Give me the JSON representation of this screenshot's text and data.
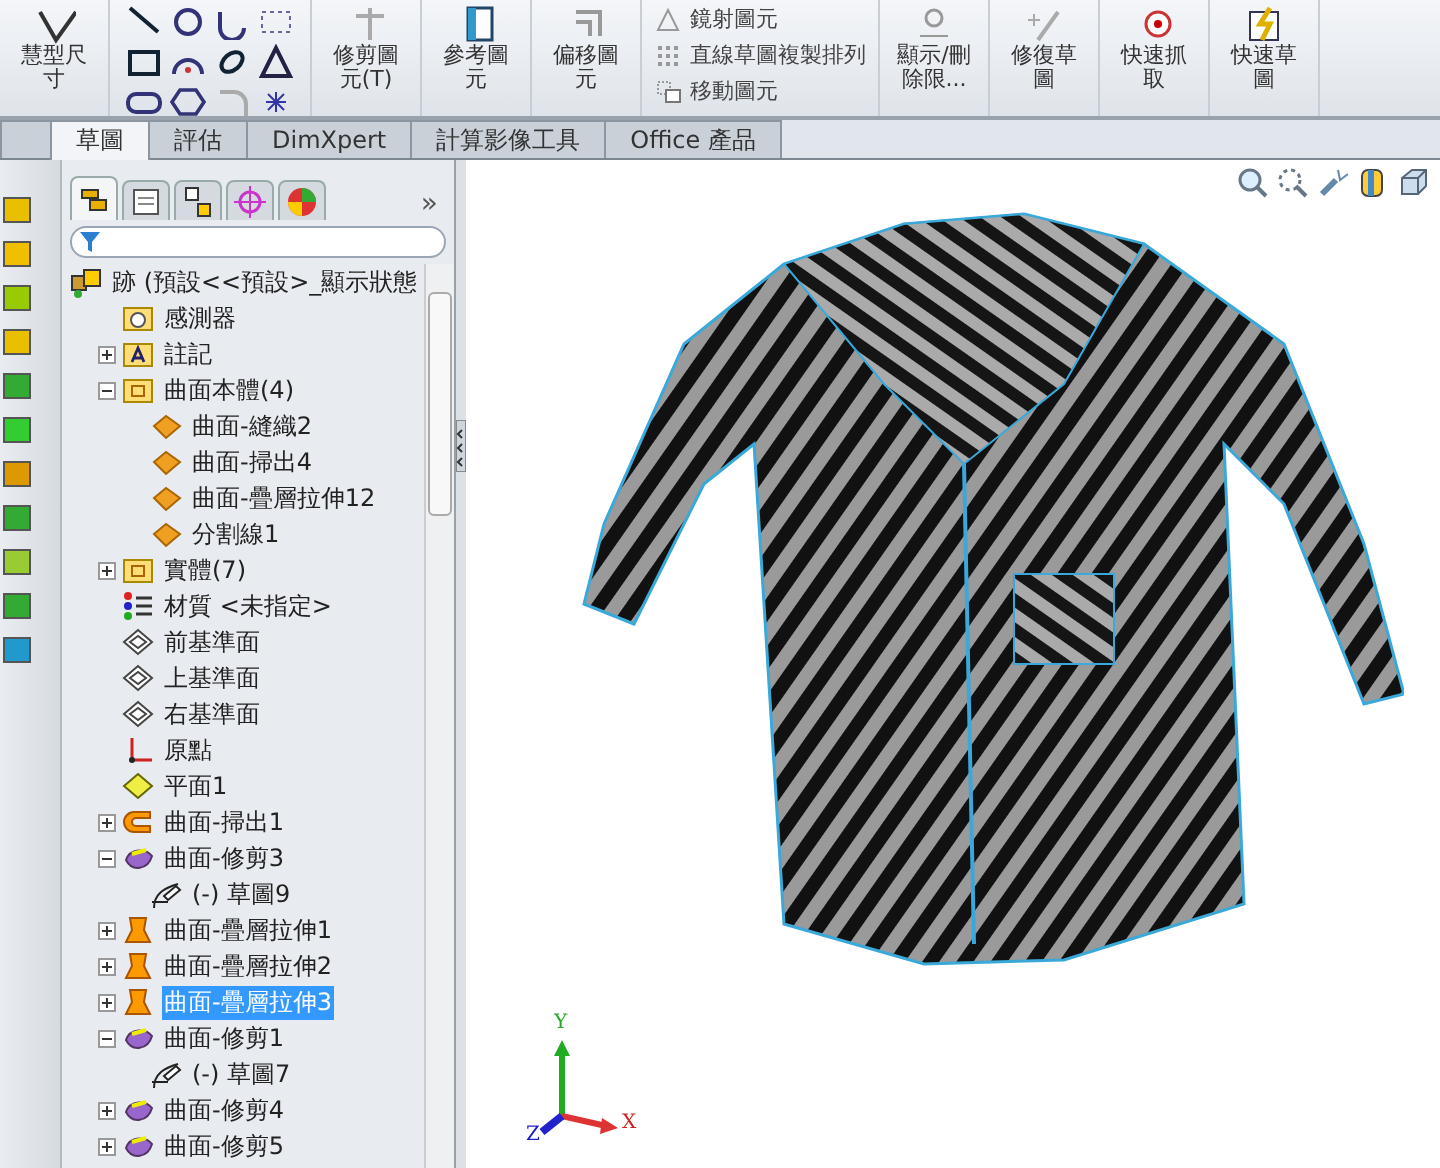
{
  "ribbon": [
    {
      "kind": "large",
      "label": "慧型尺寸"
    },
    {
      "kind": "tools"
    },
    {
      "kind": "large",
      "label": "修剪圖元(T)"
    },
    {
      "kind": "large",
      "label": "參考圖元"
    },
    {
      "kind": "large",
      "label": "偏移圖元"
    },
    {
      "kind": "rows",
      "items": [
        "鏡射圖元",
        "直線草圖複製排列",
        "移動圖元"
      ]
    },
    {
      "kind": "large",
      "label": "顯示/刪除限..."
    },
    {
      "kind": "large",
      "label": "修復草圖"
    },
    {
      "kind": "large",
      "label": "快速抓取"
    },
    {
      "kind": "large",
      "label": "快速草圖"
    }
  ],
  "tabs": [
    {
      "selected": false
    },
    {
      "label": "草圖",
      "selected": true
    },
    {
      "label": "評估",
      "selected": false
    },
    {
      "label": "DimXpert",
      "selected": false
    },
    {
      "label": "計算影像工具",
      "selected": false
    },
    {
      "label": "Office 產品",
      "selected": false
    }
  ],
  "panel_tabs": [
    {
      "kind": "feature",
      "selected": true
    },
    {
      "kind": "property",
      "selected": false
    },
    {
      "kind": "config",
      "selected": false
    },
    {
      "kind": "dim",
      "selected": false
    },
    {
      "kind": "display",
      "selected": false
    }
  ],
  "panel_overflow": "»",
  "tree": [
    {
      "kind": "part",
      "label": "跡 (預設<<預設>_顯示狀態",
      "selected": false,
      "children": [
        {
          "kind": "sensor",
          "label": "感測器",
          "selected": false
        },
        {
          "kind": "annotation",
          "label": "註記",
          "selected": false,
          "expanded": false
        },
        {
          "kind": "folder",
          "label": "曲面本體(4)",
          "selected": false,
          "expanded": true,
          "children": [
            {
              "kind": "surface",
              "label": "曲面-縫織2",
              "selected": false
            },
            {
              "kind": "surface",
              "label": "曲面-掃出4",
              "selected": false
            },
            {
              "kind": "surface",
              "label": "曲面-疊層拉伸12",
              "selected": false
            },
            {
              "kind": "surface",
              "label": "分割線1",
              "selected": false
            }
          ]
        },
        {
          "kind": "folder",
          "label": "實體(7)",
          "selected": false,
          "expanded": false
        },
        {
          "kind": "material",
          "label": "材質 <未指定>",
          "selected": false
        },
        {
          "kind": "plane",
          "label": "前基準面",
          "selected": false
        },
        {
          "kind": "plane",
          "label": "上基準面",
          "selected": false
        },
        {
          "kind": "plane",
          "label": "右基準面",
          "selected": false
        },
        {
          "kind": "origin",
          "label": "原點",
          "selected": false
        },
        {
          "kind": "refplane",
          "label": "平面1",
          "selected": false
        },
        {
          "kind": "sweep",
          "label": "曲面-掃出1",
          "selected": false,
          "expanded": false
        },
        {
          "kind": "trim",
          "label": "曲面-修剪3",
          "selected": false,
          "expanded": true,
          "children": [
            {
              "kind": "sketch",
              "label": "(-) 草圖9",
              "selected": false
            }
          ]
        },
        {
          "kind": "loft",
          "label": "曲面-疊層拉伸1",
          "selected": false,
          "expanded": false
        },
        {
          "kind": "loft",
          "label": "曲面-疊層拉伸2",
          "selected": false,
          "expanded": false
        },
        {
          "kind": "loft",
          "label": "曲面-疊層拉伸3",
          "selected": true,
          "expanded": false
        },
        {
          "kind": "trim",
          "label": "曲面-修剪1",
          "selected": false,
          "expanded": true,
          "children": [
            {
              "kind": "sketch",
              "label": "(-) 草圖7",
              "selected": false
            }
          ]
        },
        {
          "kind": "trim",
          "label": "曲面-修剪4",
          "selected": false,
          "expanded": false
        },
        {
          "kind": "trim",
          "label": "曲面-修剪5",
          "selected": false,
          "expanded": false
        }
      ]
    }
  ],
  "triad": {
    "y": "Y",
    "x": "X",
    "z": "Z"
  }
}
